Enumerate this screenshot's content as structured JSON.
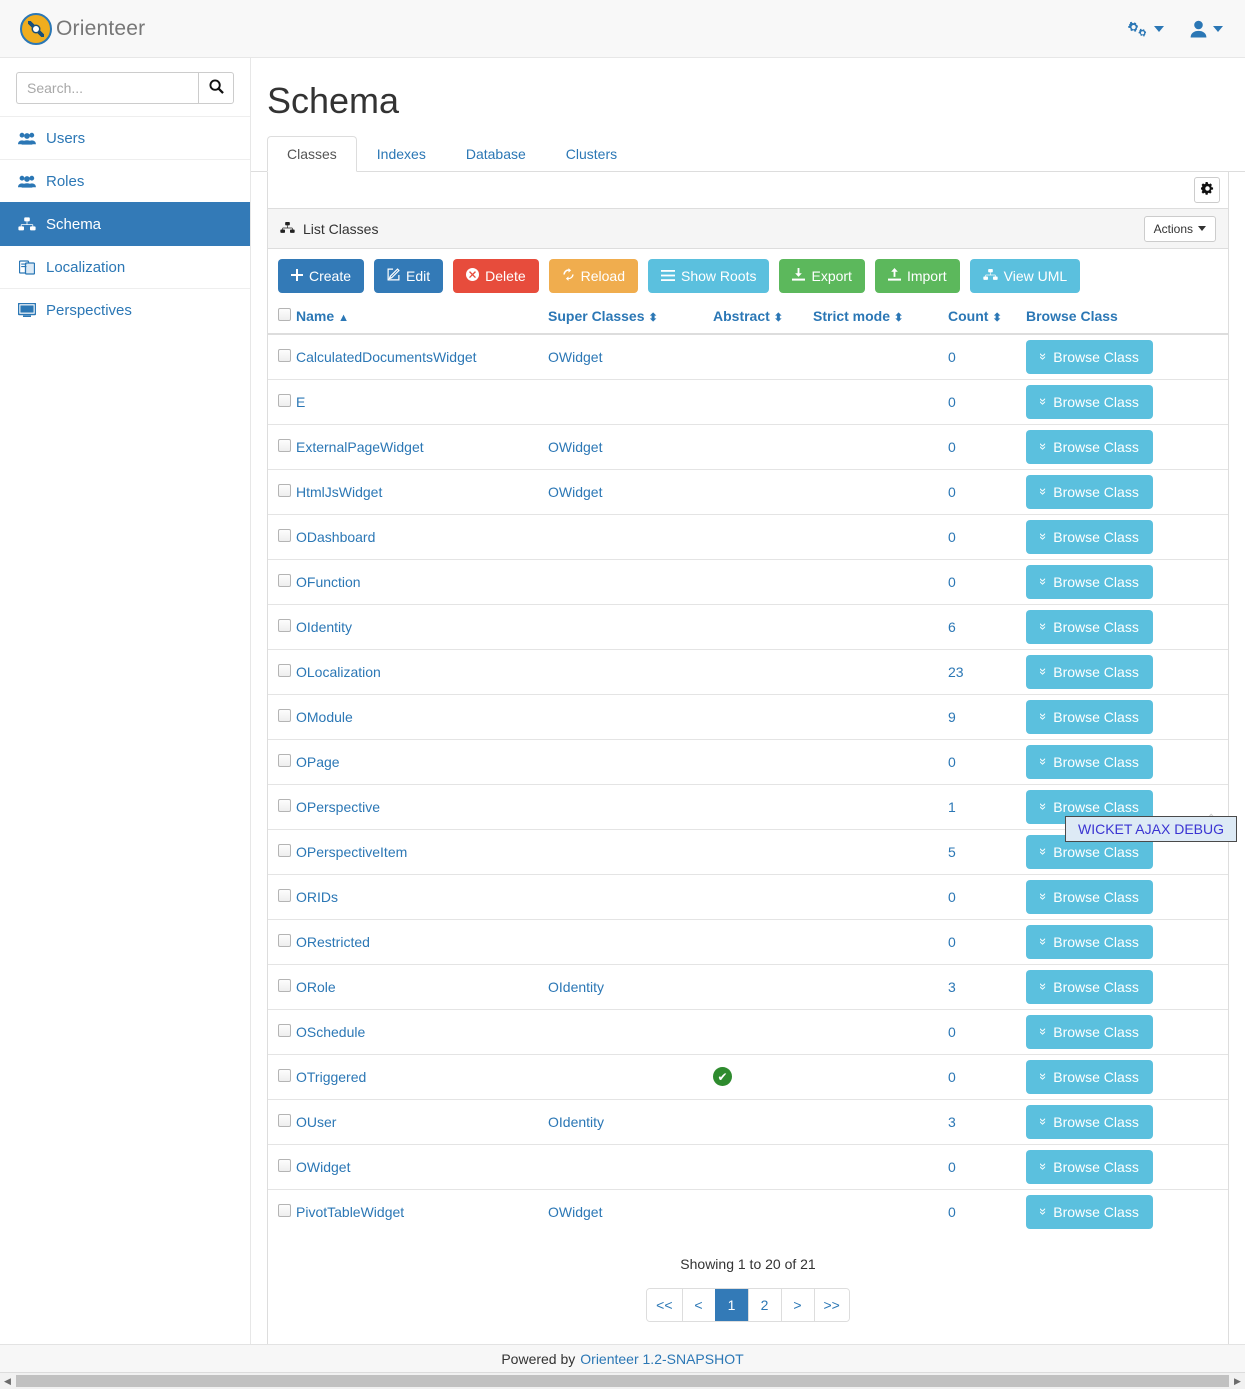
{
  "app": {
    "brand": "Orienteer",
    "logo_color": "#f0ad1e",
    "accent_color": "#337ab7"
  },
  "topbar": {
    "settings_menu_icon": "gears-icon",
    "user_menu_icon": "user-icon"
  },
  "sidebar": {
    "search_placeholder": "Search...",
    "search_value": "",
    "items": [
      {
        "label": "Users",
        "icon": "users-icon",
        "active": false
      },
      {
        "label": "Roles",
        "icon": "users-icon",
        "active": false
      },
      {
        "label": "Schema",
        "icon": "sitemap-icon",
        "active": true
      },
      {
        "label": "Localization",
        "icon": "language-icon",
        "active": false
      },
      {
        "label": "Perspectives",
        "icon": "desktop-icon",
        "active": false
      }
    ]
  },
  "main": {
    "page_title": "Schema",
    "tabs": [
      {
        "label": "Classes",
        "active": true
      },
      {
        "label": "Indexes",
        "active": false
      },
      {
        "label": "Database",
        "active": false
      },
      {
        "label": "Clusters",
        "active": false
      }
    ],
    "settings_gear_icon": "gear-icon",
    "panel": {
      "title": "List Classes",
      "title_icon": "sitemap-icon",
      "actions_label": "Actions",
      "toolbar": [
        {
          "label": "Create",
          "icon": "plus-icon",
          "style": "primary"
        },
        {
          "label": "Edit",
          "icon": "pencil-icon",
          "style": "primary"
        },
        {
          "label": "Delete",
          "icon": "times-icon",
          "style": "danger"
        },
        {
          "label": "Reload",
          "icon": "refresh-icon",
          "style": "warning"
        },
        {
          "label": "Show Roots",
          "icon": "bars-icon",
          "style": "info"
        },
        {
          "label": "Export",
          "icon": "download-icon",
          "style": "success"
        },
        {
          "label": "Import",
          "icon": "upload-icon",
          "style": "success"
        },
        {
          "label": "View UML",
          "icon": "sitemap-icon",
          "style": "info"
        }
      ]
    },
    "table": {
      "columns": [
        {
          "key": "name",
          "label": "Name",
          "sort": "asc"
        },
        {
          "key": "super",
          "label": "Super Classes",
          "sort": "both"
        },
        {
          "key": "abs",
          "label": "Abstract",
          "sort": "both"
        },
        {
          "key": "strict",
          "label": "Strict mode",
          "sort": "both"
        },
        {
          "key": "count",
          "label": "Count",
          "sort": "both"
        },
        {
          "key": "browse",
          "label": "Browse Class",
          "sort": "none"
        }
      ],
      "browse_label": "Browse Class",
      "rows": [
        {
          "name": "CalculatedDocumentsWidget",
          "super": "OWidget",
          "abstract": false,
          "strict": false,
          "count": "0"
        },
        {
          "name": "E",
          "super": "",
          "abstract": false,
          "strict": false,
          "count": "0"
        },
        {
          "name": "ExternalPageWidget",
          "super": "OWidget",
          "abstract": false,
          "strict": false,
          "count": "0"
        },
        {
          "name": "HtmlJsWidget",
          "super": "OWidget",
          "abstract": false,
          "strict": false,
          "count": "0"
        },
        {
          "name": "ODashboard",
          "super": "",
          "abstract": false,
          "strict": false,
          "count": "0"
        },
        {
          "name": "OFunction",
          "super": "",
          "abstract": false,
          "strict": false,
          "count": "0"
        },
        {
          "name": "OIdentity",
          "super": "",
          "abstract": false,
          "strict": false,
          "count": "6"
        },
        {
          "name": "OLocalization",
          "super": "",
          "abstract": false,
          "strict": false,
          "count": "23"
        },
        {
          "name": "OModule",
          "super": "",
          "abstract": false,
          "strict": false,
          "count": "9"
        },
        {
          "name": "OPage",
          "super": "",
          "abstract": false,
          "strict": false,
          "count": "0"
        },
        {
          "name": "OPerspective",
          "super": "",
          "abstract": false,
          "strict": false,
          "count": "1"
        },
        {
          "name": "OPerspectiveItem",
          "super": "",
          "abstract": false,
          "strict": false,
          "count": "5"
        },
        {
          "name": "ORIDs",
          "super": "",
          "abstract": false,
          "strict": false,
          "count": "0"
        },
        {
          "name": "ORestricted",
          "super": "",
          "abstract": false,
          "strict": false,
          "count": "0"
        },
        {
          "name": "ORole",
          "super": "OIdentity",
          "abstract": false,
          "strict": false,
          "count": "3"
        },
        {
          "name": "OSchedule",
          "super": "",
          "abstract": false,
          "strict": false,
          "count": "0"
        },
        {
          "name": "OTriggered",
          "super": "",
          "abstract": true,
          "strict": false,
          "count": "0"
        },
        {
          "name": "OUser",
          "super": "OIdentity",
          "abstract": false,
          "strict": false,
          "count": "3"
        },
        {
          "name": "OWidget",
          "super": "",
          "abstract": false,
          "strict": false,
          "count": "0"
        },
        {
          "name": "PivotTableWidget",
          "super": "OWidget",
          "abstract": false,
          "strict": false,
          "count": "0"
        }
      ],
      "showing_text": "Showing 1 to 20 of 21",
      "pagination": [
        {
          "label": "<<",
          "active": false
        },
        {
          "label": "<",
          "active": false
        },
        {
          "label": "1",
          "active": true
        },
        {
          "label": "2",
          "active": false
        },
        {
          "label": ">",
          "active": false
        },
        {
          "label": ">>",
          "active": false
        }
      ]
    }
  },
  "overlay": {
    "wicket_debug_label": "WICKET AJAX DEBUG",
    "back_to_top_icon": "chevron-up-icon"
  },
  "footer": {
    "powered_by": "Powered by",
    "link": "Orienteer 1.2-SNAPSHOT"
  }
}
